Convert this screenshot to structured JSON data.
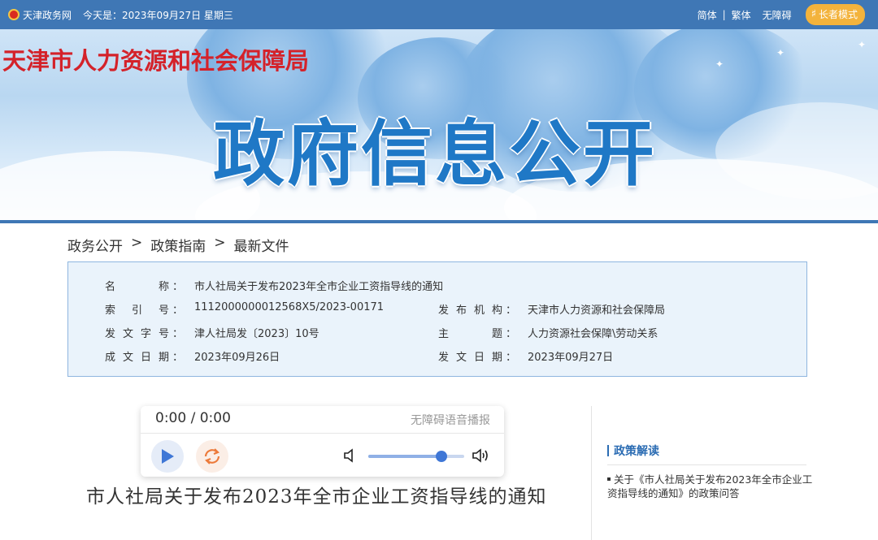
{
  "topbar": {
    "site_name": "天津政务网",
    "date_text": "今天是：2023年09月27日 星期三",
    "links": [
      "简体",
      "繁体",
      "无障碍"
    ],
    "separator": "|",
    "elder_mode": "长者模式"
  },
  "banner": {
    "bureau_name": "天津市人力资源和社会保障局",
    "title": "政府信息公开"
  },
  "breadcrumb": {
    "items": [
      "政务公开",
      "政策指南",
      "最新文件"
    ],
    "arrow": ">"
  },
  "info": {
    "name_label": "名称",
    "name_value": "市人社局关于发布2023年全市企业工资指导线的通知",
    "index_label": "索引号",
    "index_value": "1112000000012568X5/2023-00171",
    "publisher_label": "发布机构",
    "publisher_value": "天津市人力资源和社会保障局",
    "doc_no_label": "发文字号",
    "doc_no_value": "津人社局发〔2023〕10号",
    "topic_label": "主题",
    "topic_value": "人力资源社会保障\\劳动关系",
    "written_label": "成文日期",
    "written_value": "2023年09月26日",
    "issued_label": "发文日期",
    "issued_value": "2023年09月27日",
    "colon": "："
  },
  "player": {
    "time": "0:00 / 0:00",
    "tts_label": "无障碍语音播报",
    "volume_level": 0.76,
    "accent": "#3f77d6"
  },
  "document": {
    "title": "市人社局关于发布2023年全市企业工资指导线的通知"
  },
  "sidebar": {
    "heading": "政策解读",
    "link": "关于《市人社局关于发布2023年全市企业工资指导线的通知》的政策问答"
  },
  "colors": {
    "topbar": "#3f77b5",
    "bureau_red": "#d4222a",
    "banner_blue": "#1f78c6",
    "elder_btn": "#f3b33c"
  }
}
